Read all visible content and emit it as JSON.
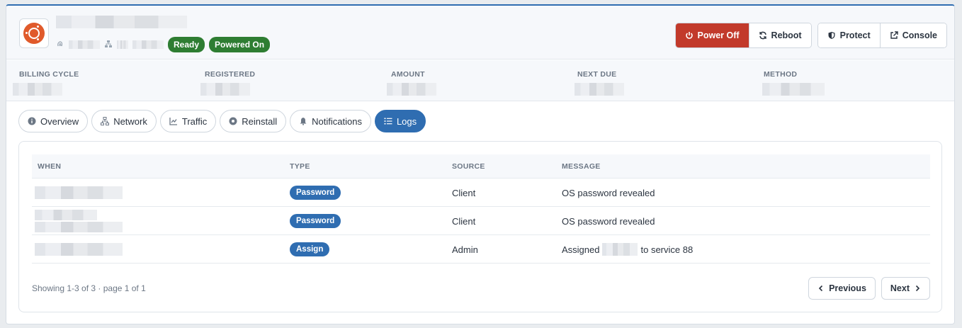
{
  "header": {
    "os_icon": "ubuntu-logo",
    "badges": {
      "ready": "Ready",
      "powered_on": "Powered On"
    }
  },
  "actions": {
    "power_off": "Power Off",
    "reboot": "Reboot",
    "protect": "Protect",
    "console": "Console"
  },
  "billing": {
    "billing_cycle": "BILLING CYCLE",
    "registered": "REGISTERED",
    "amount": "AMOUNT",
    "next_due": "NEXT DUE",
    "method": "METHOD"
  },
  "tabs": {
    "overview": "Overview",
    "network": "Network",
    "traffic": "Traffic",
    "reinstall": "Reinstall",
    "notifications": "Notifications",
    "logs": "Logs"
  },
  "table": {
    "columns": {
      "when": "WHEN",
      "type": "TYPE",
      "source": "SOURCE",
      "message": "MESSAGE"
    },
    "rows": [
      {
        "type": "Password",
        "source": "Client",
        "message": "OS password revealed"
      },
      {
        "type": "Password",
        "source": "Client",
        "message": "OS password revealed"
      },
      {
        "type": "Assign",
        "source": "Admin",
        "message_prefix": "Assigned",
        "message_suffix": "to service 88"
      }
    ]
  },
  "footer": {
    "showing": "Showing 1-3 of 3 · page 1 of 1",
    "previous": "Previous",
    "next": "Next"
  },
  "colors": {
    "primary": "#2f6db1",
    "danger": "#c23a2b",
    "success": "#2e7d32"
  }
}
